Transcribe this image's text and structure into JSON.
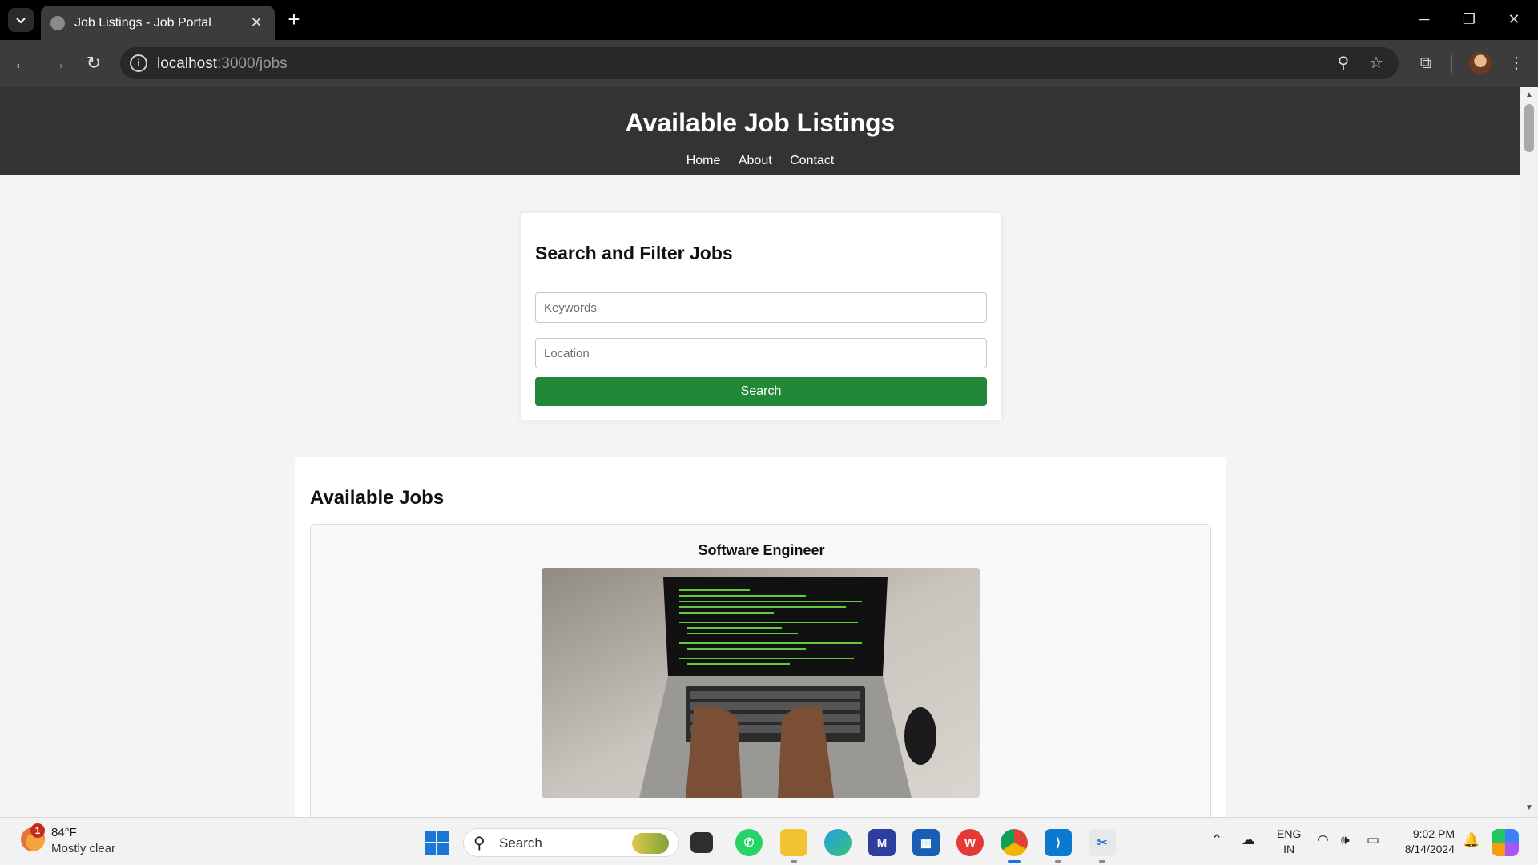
{
  "browser": {
    "tab_title": "Job Listings - Job Portal",
    "url_host": "localhost",
    "url_path": ":3000/jobs"
  },
  "page": {
    "header": {
      "title": "Available Job Listings",
      "nav": [
        "Home",
        "About",
        "Contact"
      ]
    },
    "search": {
      "heading": "Search and Filter Jobs",
      "keywords_placeholder": "Keywords",
      "location_placeholder": "Location",
      "button_label": "Search"
    },
    "jobs": {
      "heading": "Available Jobs",
      "items": [
        {
          "title": "Software Engineer",
          "image": "laptop-code-photo"
        }
      ]
    },
    "colors": {
      "header_bg": "#333333",
      "search_button": "#218838"
    }
  },
  "taskbar": {
    "weather_badge": "1",
    "weather_temp": "84°F",
    "weather_desc": "Mostly clear",
    "search_label": "Search",
    "lang_line1": "ENG",
    "lang_line2": "IN",
    "time": "9:02 PM",
    "date": "8/14/2024",
    "apps": [
      "whatsapp-icon",
      "file-explorer-icon",
      "edge-icon",
      "store-icon",
      "wps-icon",
      "chrome-icon",
      "vscode-icon",
      "snipping-tool-icon"
    ]
  }
}
